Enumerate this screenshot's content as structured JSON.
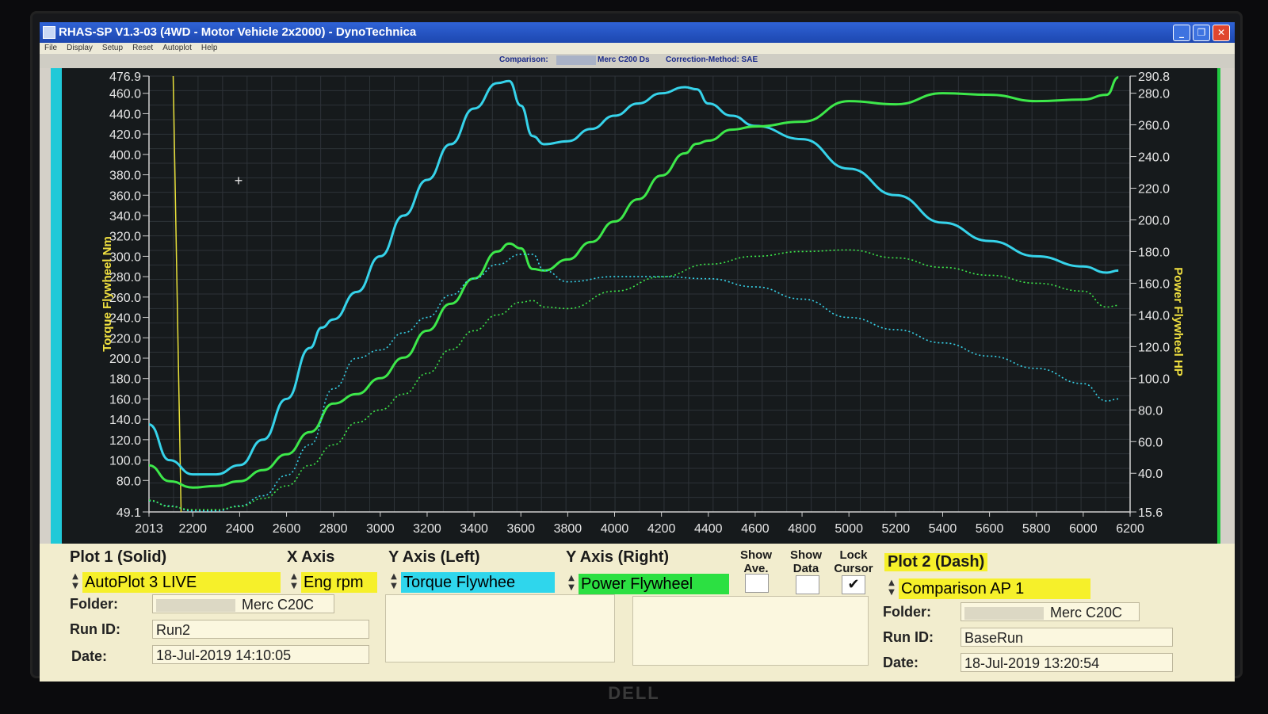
{
  "window": {
    "title": "RHAS-SP V1.3-03  (4WD - Motor Vehicle 2x2000) - DynoTechnica",
    "minimize_icon": "minimize-icon",
    "maximize_icon": "restore-icon",
    "close_icon": "close-icon"
  },
  "menu": [
    "File",
    "Display",
    "Setup",
    "Reset",
    "Autoplot",
    "Help"
  ],
  "infobar": {
    "comparison_label": "Comparison:",
    "comparison_value": "Merc C200 Ds",
    "correction_label": "Correction-Method: SAE"
  },
  "colors": {
    "torque": "#36d3ea",
    "power": "#3de84a",
    "cursor": "#e8e03a",
    "axis_label": "#f0e040",
    "plot_bg": "#161a1c"
  },
  "chart_data": {
    "type": "line",
    "xlabel": "",
    "ylabel_left": "Torque Flywheel Nm",
    "ylabel_right": "Power Flywheel HP",
    "xlim": [
      2013,
      6200
    ],
    "ylim_left": [
      49.1,
      476.9
    ],
    "ylim_right": [
      15.6,
      290.8
    ],
    "x_ticks": [
      "2013",
      "2200",
      "2400",
      "2600",
      "2800",
      "3000",
      "3200",
      "3400",
      "3600",
      "3800",
      "4000",
      "4200",
      "4400",
      "4600",
      "4800",
      "5000",
      "5200",
      "5400",
      "5600",
      "5800",
      "6000",
      "6200"
    ],
    "x_tick_values": [
      2013,
      2200,
      2400,
      2600,
      2800,
      3000,
      3200,
      3400,
      3600,
      3800,
      4000,
      4200,
      4400,
      4600,
      4800,
      5000,
      5200,
      5400,
      5600,
      5800,
      6000,
      6200
    ],
    "y_left_ticks": [
      "49.1",
      "80.0",
      "100.0",
      "120.0",
      "140.0",
      "160.0",
      "180.0",
      "200.0",
      "220.0",
      "240.0",
      "260.0",
      "280.0",
      "300.0",
      "320.0",
      "340.0",
      "360.0",
      "380.0",
      "400.0",
      "420.0",
      "440.0",
      "460.0",
      "476.9"
    ],
    "y_left_tick_values": [
      49.1,
      80,
      100,
      120,
      140,
      160,
      180,
      200,
      220,
      240,
      260,
      280,
      300,
      320,
      340,
      360,
      380,
      400,
      420,
      440,
      460,
      476.9
    ],
    "y_right_ticks": [
      "15.6",
      "40.0",
      "60.0",
      "80.0",
      "100.0",
      "120.0",
      "140.0",
      "160.0",
      "180.0",
      "200.0",
      "220.0",
      "240.0",
      "260.0",
      "280.0",
      "290.8"
    ],
    "y_right_tick_values": [
      15.6,
      40,
      60,
      80,
      100,
      120,
      140,
      160,
      180,
      200,
      220,
      240,
      260,
      280,
      290.8
    ],
    "cursor_x": 2150,
    "series": [
      {
        "name": "Torque Flywheel (Plot 1)",
        "axis": "left",
        "style": "solid",
        "color": "#36d3ea",
        "x": [
          2013,
          2100,
          2200,
          2300,
          2400,
          2500,
          2600,
          2700,
          2750,
          2800,
          2900,
          3000,
          3100,
          3200,
          3300,
          3400,
          3500,
          3550,
          3600,
          3650,
          3700,
          3800,
          3900,
          4000,
          4100,
          4200,
          4300,
          4350,
          4400,
          4500,
          4600,
          4800,
          5000,
          5200,
          5400,
          5600,
          5800,
          6000,
          6100,
          6150
        ],
        "y": [
          135,
          100,
          86,
          86,
          95,
          120,
          160,
          210,
          230,
          238,
          265,
          300,
          340,
          375,
          410,
          445,
          470,
          472,
          448,
          418,
          410,
          413,
          425,
          438,
          450,
          460,
          466,
          464,
          450,
          438,
          428,
          415,
          386,
          360,
          333,
          315,
          300,
          290,
          284,
          286
        ]
      },
      {
        "name": "Power Flywheel (Plot 1)",
        "axis": "right",
        "style": "solid",
        "color": "#3de84a",
        "x": [
          2013,
          2100,
          2200,
          2300,
          2400,
          2500,
          2600,
          2700,
          2800,
          2900,
          3000,
          3100,
          3200,
          3300,
          3400,
          3500,
          3550,
          3600,
          3650,
          3700,
          3800,
          3900,
          4000,
          4100,
          4200,
          4300,
          4350,
          4400,
          4500,
          4600,
          4800,
          5000,
          5200,
          5400,
          5600,
          5800,
          6000,
          6100,
          6150
        ],
        "y": [
          45,
          35,
          31,
          32,
          35,
          42,
          52,
          66,
          84,
          90,
          100,
          113,
          130,
          147,
          163,
          180,
          185,
          182,
          169,
          168,
          175,
          186,
          199,
          213,
          228,
          242,
          248,
          250,
          257,
          259,
          262,
          275,
          273,
          280,
          279,
          275,
          276,
          279,
          290
        ]
      },
      {
        "name": "Torque Flywheel (Plot 2)",
        "axis": "left",
        "style": "dashed",
        "color": "#36d3ea",
        "x": [
          2013,
          2100,
          2200,
          2300,
          2400,
          2500,
          2600,
          2700,
          2800,
          2900,
          3000,
          3100,
          3200,
          3300,
          3400,
          3500,
          3600,
          3650,
          3700,
          3800,
          4000,
          4200,
          4400,
          4600,
          4800,
          5000,
          5200,
          5400,
          5600,
          5800,
          6000,
          6100,
          6150
        ],
        "y": [
          60,
          55,
          50,
          50,
          55,
          65,
          85,
          115,
          170,
          200,
          208,
          225,
          240,
          262,
          278,
          292,
          302,
          302,
          286,
          275,
          280,
          280,
          278,
          270,
          258,
          240,
          228,
          215,
          202,
          190,
          175,
          158,
          160
        ]
      },
      {
        "name": "Power Flywheel (Plot 2)",
        "axis": "right",
        "style": "dashed",
        "color": "#3de84a",
        "x": [
          2013,
          2100,
          2200,
          2300,
          2400,
          2500,
          2600,
          2700,
          2800,
          2900,
          3000,
          3100,
          3200,
          3300,
          3400,
          3500,
          3600,
          3650,
          3700,
          3800,
          4000,
          4200,
          4400,
          4600,
          4800,
          5000,
          5200,
          5400,
          5600,
          5800,
          6000,
          6100,
          6150
        ],
        "y": [
          23,
          19,
          17,
          17,
          19,
          24,
          32,
          45,
          58,
          72,
          80,
          90,
          103,
          118,
          130,
          140,
          148,
          149,
          145,
          144,
          155,
          164,
          172,
          177,
          180,
          181,
          176,
          170,
          165,
          160,
          155,
          145,
          146
        ]
      }
    ]
  },
  "panel": {
    "plot1_header": "Plot 1 (Solid)",
    "xaxis_header": "X Axis",
    "yleft_header": "Y Axis (Left)",
    "yright_header": "Y Axis (Right)",
    "show_ave_header": "Show Ave.",
    "show_data_header": "Show Data",
    "lock_cursor_header": "Lock Cursor",
    "plot2_header": "Plot 2 (Dash)",
    "plot1_source": "AutoPlot 3 LIVE",
    "xaxis_value": "Eng rpm",
    "yleft_value": "Torque Flywhee",
    "yright_value": "Power Flywheel",
    "plot2_source": "Comparison AP 1",
    "show_ave_checked": "",
    "show_data_checked": "",
    "lock_cursor_checked": "✔",
    "folder_label": "Folder:",
    "run_id_label": "Run ID:",
    "date_label": "Date:",
    "plot1_folder": "Merc C20C",
    "plot1_run_id": "Run2",
    "plot1_date": "18-Jul-2019  14:10:05",
    "plot2_folder": "Merc C20C",
    "plot2_run_id": "BaseRun",
    "plot2_date": "18-Jul-2019  13:20:54"
  },
  "monitor": {
    "brand": "DELL"
  }
}
